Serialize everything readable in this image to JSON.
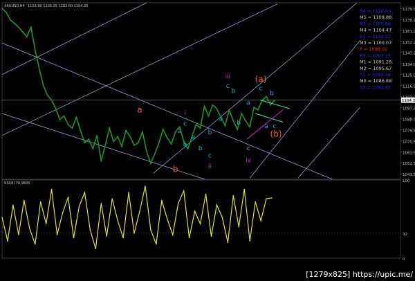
{
  "header": {
    "symbol": "XAUUSD,H4",
    "quotes": "1103.90 1105.35 1102.60 1104.35"
  },
  "watermark": "[1279x825] https://upic.me/",
  "colors": {
    "background": "#000000",
    "price": "#1a9a1a",
    "rsi": "#e8e81a",
    "channel": "#8aa0d8",
    "grid": "#303030",
    "wave_cyan": "#00b7f0",
    "wave_magenta": "#d020d0",
    "wave_orange": "#ff5a1a",
    "pivot_p": "#ff2020",
    "pivot_r": "#2030ff",
    "pivot_m": "#cfcfcf",
    "trend_green": "#30e0b0"
  },
  "chart_data": [
    {
      "type": "line",
      "title": "XAUUSD,H4",
      "series": [
        {
          "name": "",
          "x_index": [
            0,
            6,
            12,
            18,
            24,
            30,
            36,
            42,
            48,
            54,
            60,
            66,
            72,
            78,
            84,
            90,
            96,
            102,
            108,
            114,
            120,
            126,
            132,
            138,
            144,
            150,
            156,
            162,
            168,
            174,
            180,
            186,
            192,
            198,
            204,
            210,
            216,
            222,
            228,
            234,
            240,
            246,
            252,
            258,
            264,
            270,
            276,
            282,
            288,
            294,
            300,
            306,
            312,
            318,
            324,
            330,
            336,
            342,
            348,
            354,
            360,
            366,
            372,
            378,
            384,
            390,
            396
          ],
          "values": [
            1179.5,
            1176,
            1170,
            1167,
            1164,
            1160,
            1156,
            1164,
            1145,
            1130,
            1116,
            1108,
            1104,
            1097,
            1088,
            1091,
            1084,
            1081,
            1090,
            1079,
            1069,
            1072,
            1064,
            1075,
            1054,
            1067,
            1081,
            1070,
            1074,
            1066,
            1079,
            1074,
            1067,
            1069,
            1078,
            1062,
            1052,
            1060,
            1069,
            1080,
            1073,
            1068,
            1078,
            1082,
            1070,
            1064,
            1074,
            1084,
            1081,
            1099,
            1091,
            1100,
            1097,
            1090,
            1083,
            1096,
            1087,
            1080,
            1093,
            1087,
            1082,
            1098,
            1096,
            1104,
            1107,
            1100,
            1104
          ]
        }
      ],
      "y_ticks": [
        "1179.52",
        "1170.27",
        "1161.27",
        "1152.27",
        "1143.27",
        "1134.02",
        "1125.02",
        "1116.02",
        "1107.02",
        "1097.77",
        "1088.77",
        "1079.52",
        "1070.52",
        "1061.52",
        "1052.52",
        "1043.52"
      ],
      "ylim": [
        1039,
        1184
      ],
      "current_price_label": "1104.35",
      "pivots": [
        {
          "label": "R4 = 1110.03",
          "value": 1110.03
        },
        {
          "label": "M5 = 1108.88",
          "value": 1108.88
        },
        {
          "label": "R3 = 1105.66",
          "value": 1105.66
        },
        {
          "label": "M4 = 1104.47",
          "value": 1104.47
        },
        {
          "label": "R1 = 1102.12",
          "value": 1102.12
        },
        {
          "label": "M3 = 1100.07",
          "value": 1100.07
        },
        {
          "label": "P = 1098.02",
          "value": 1098.02
        },
        {
          "label": "R1 = 1093.26",
          "value": 1093.26
        },
        {
          "label": "M1 = 1091.28",
          "value": 1091.28
        },
        {
          "label": "M2 = 1095.67",
          "value": 1095.67
        },
        {
          "label": "S1 = 1089.38",
          "value": 1089.38
        },
        {
          "label": "M0 = 1086.88",
          "value": 1086.88
        },
        {
          "label": "S3 = 1084.93",
          "value": 1084.93
        }
      ],
      "wave_labels": [
        {
          "text": "a",
          "color": "wave_orange",
          "xi": 200,
          "y": 1094
        },
        {
          "text": "b",
          "color": "wave_orange",
          "xi": 252,
          "y": 1045
        },
        {
          "text": "i",
          "color": "wave_magenta",
          "xi": 266,
          "y": 1092
        },
        {
          "text": "c",
          "color": "wave_cyan",
          "xi": 266,
          "y": 1083
        },
        {
          "text": "a",
          "color": "wave_cyan",
          "xi": 258,
          "y": 1077
        },
        {
          "text": "b",
          "color": "wave_cyan",
          "xi": 266,
          "y": 1066
        },
        {
          "text": "a",
          "color": "wave_cyan",
          "xi": 278,
          "y": 1072
        },
        {
          "text": "b",
          "color": "wave_cyan",
          "xi": 288,
          "y": 1063
        },
        {
          "text": "b",
          "color": "wave_cyan",
          "xi": 302,
          "y": 1076
        },
        {
          "text": "c",
          "color": "wave_cyan",
          "xi": 302,
          "y": 1057
        },
        {
          "text": "ii",
          "color": "wave_magenta",
          "xi": 302,
          "y": 1048
        },
        {
          "text": "a",
          "color": "wave_cyan",
          "xi": 318,
          "y": 1087
        },
        {
          "text": "iii",
          "color": "wave_magenta",
          "xi": 328,
          "y": 1122
        },
        {
          "text": "c",
          "color": "wave_cyan",
          "xi": 328,
          "y": 1114
        },
        {
          "text": "b",
          "color": "wave_cyan",
          "xi": 336,
          "y": 1110
        },
        {
          "text": "a",
          "color": "wave_cyan",
          "xi": 358,
          "y": 1100
        },
        {
          "text": "b",
          "color": "wave_cyan",
          "xi": 344,
          "y": 1084
        },
        {
          "text": "c",
          "color": "wave_cyan",
          "xi": 358,
          "y": 1063
        },
        {
          "text": "iv",
          "color": "wave_magenta",
          "xi": 358,
          "y": 1053
        },
        {
          "text": "(a)",
          "color": "wave_orange",
          "xi": 376,
          "y": 1119
        },
        {
          "text": "c",
          "color": "wave_cyan",
          "xi": 376,
          "y": 1112
        },
        {
          "text": "b",
          "color": "wave_cyan",
          "xi": 392,
          "y": 1108
        },
        {
          "text": "a",
          "color": "wave_cyan",
          "xi": 384,
          "y": 1081
        },
        {
          "text": "c",
          "color": "wave_cyan",
          "xi": 396,
          "y": 1081
        },
        {
          "text": "(b)",
          "color": "wave_orange",
          "xi": 398,
          "y": 1074
        }
      ],
      "channel_lines": [
        {
          "xi1": 0,
          "y1": 1151,
          "xi2": 600,
          "y2": 1011
        },
        {
          "xi1": 0,
          "y1": 1093,
          "xi2": 600,
          "y2": 983
        },
        {
          "xi1": 0,
          "y1": 1075,
          "xi2": 400,
          "y2": 1183
        },
        {
          "xi1": 220,
          "y1": 1044,
          "xi2": 520,
          "y2": 1186
        },
        {
          "xi1": 360,
          "y1": 1040,
          "xi2": 520,
          "y2": 1153
        },
        {
          "xi1": 430,
          "y1": 1040,
          "xi2": 520,
          "y2": 1098
        },
        {
          "xi1": 0,
          "y1": 1125,
          "xi2": 210,
          "y2": 1184
        }
      ],
      "wave_lines": [
        {
          "color": "trend_green",
          "xi1": 376,
          "y1": 1104,
          "xi2": 418,
          "y2": 1097
        },
        {
          "color": "trend_green",
          "xi1": 368,
          "y1": 1093,
          "xi2": 408,
          "y2": 1086
        },
        {
          "color": "wave_magenta",
          "xi1": 356,
          "y1": 1072,
          "xi2": 408,
          "y2": 1096
        }
      ]
    },
    {
      "type": "line",
      "title": "RSI(8) 76.9609",
      "y_ticks": [
        "100",
        "32",
        "0"
      ],
      "ylim": [
        0,
        100
      ],
      "series": [
        {
          "name": "",
          "x_index": [
            0,
            8,
            16,
            24,
            32,
            40,
            48,
            56,
            64,
            72,
            80,
            88,
            96,
            104,
            112,
            120,
            128,
            136,
            144,
            152,
            160,
            168,
            176,
            184,
            192,
            200,
            208,
            216,
            224,
            232,
            240,
            248,
            256,
            264,
            272,
            280,
            288,
            296,
            304,
            312,
            320,
            328,
            336,
            344,
            352,
            360,
            368,
            376,
            384,
            392
          ],
          "values": [
            52,
            22,
            68,
            30,
            74,
            38,
            18,
            72,
            44,
            88,
            30,
            58,
            78,
            26,
            66,
            84,
            36,
            12,
            70,
            28,
            76,
            48,
            26,
            84,
            32,
            60,
            92,
            36,
            18,
            74,
            50,
            30,
            70,
            86,
            26,
            60,
            44,
            82,
            28,
            68,
            52,
            20,
            80,
            40,
            88,
            22,
            72,
            48,
            76,
            77
          ]
        }
      ]
    }
  ]
}
